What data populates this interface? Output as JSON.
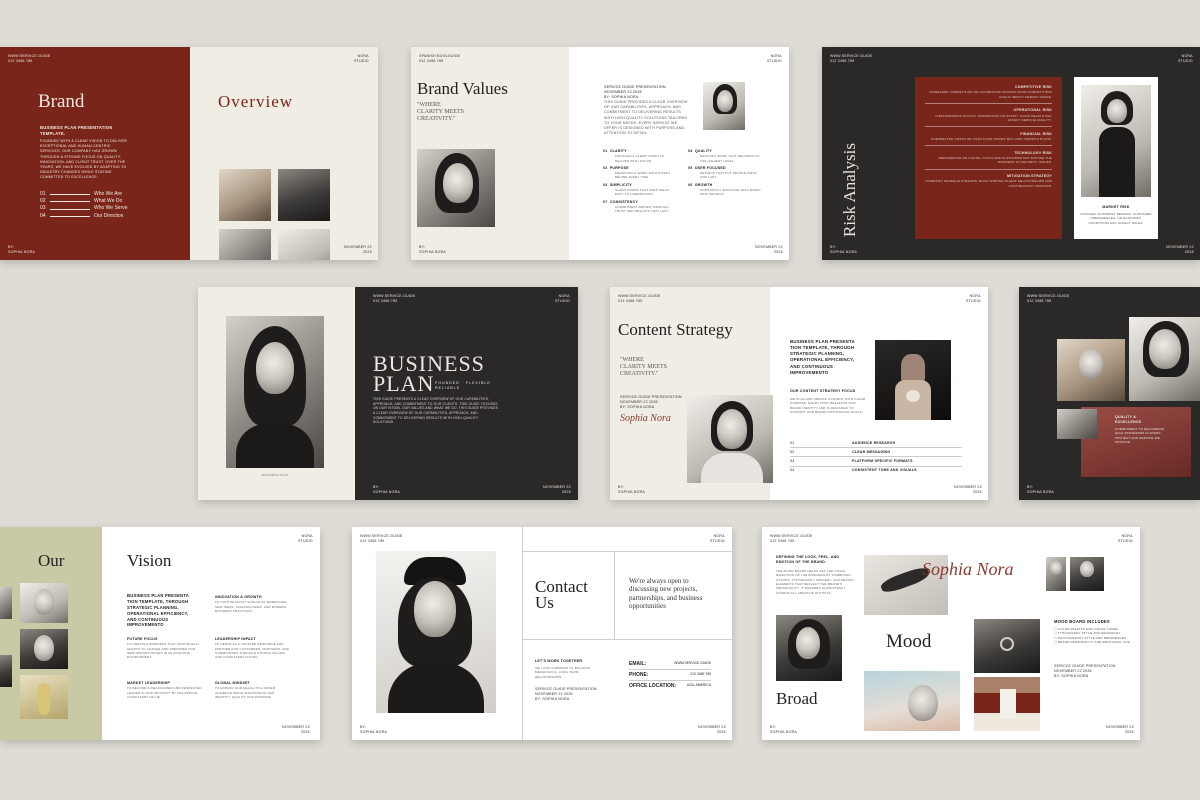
{
  "brand_slide": {
    "contact": "WWW.SERVICE.GUIDE\n012 3456 789",
    "studio": "NORA\nSTUDIO",
    "title": "Brand",
    "overview": "Overview",
    "subtitle": "BUSINESS PLAN PRESENTATION TEMPLATE.",
    "body": "FOUNDED WITH A CLEAR VISION TO DELIVER EXCEPTIONAL AND HUMAN-CENTRIC SERVICES. OUR COMPANY HAS GROWN THROUGH A STRONG FOCUS ON QUALITY, INNOVATION, AND CLIENT TRUST. OVER THE YEARS, WE HAVE EVOLVED BY ADAPTING TO INDUSTRY CHANGES WHILE STAYING COMMITTED TO EXCELLENCE.",
    "menu": [
      {
        "num": "01",
        "label": "Who We Are"
      },
      {
        "num": "02",
        "label": "What We Do"
      },
      {
        "num": "03",
        "label": "Who We Serve"
      },
      {
        "num": "04",
        "label": "Our Direction"
      }
    ],
    "author": "BY:\nSOPHIA NORA",
    "date": "NOVEMBER 22\n2026"
  },
  "values_slide": {
    "contact": "SPANISH BOOLGUIDE\n012 3456 789",
    "studio": "NORA\nSTUDIO",
    "title": "Brand Values",
    "quote": "\"WHERE\nCLARITY MEETS\nCREATIVITY.\"",
    "intro_head": "SERVICE GUIDE PRESENTATION\nNOVEMBER 22 2026\nBY: SOPHIA NORA",
    "intro_body": "THIS GUIDE PROVIDES A CLEAR OVERVIEW OF OUR CAPABILITIES, APPROACH, AND COMMITMENT TO DELIVERING RESULTS WITH HIGH-QUALITY SOLUTIONS TAILORED TO YOUR NEEDS. EVERY SERVICE WE OFFER IS DESIGNED WITH PURPOSE AND ATTENTION TO DETAIL.",
    "values": [
      {
        "num": "01",
        "label": "CLARITY",
        "desc": "THROUGH A CLEAR VISION TO DELIVER WITH FOCUS"
      },
      {
        "num": "04",
        "label": "QUALITY",
        "desc": "DETAILED WORK THAT DELIVERS TO THE HIGHEST LEVEL"
      },
      {
        "num": "02",
        "label": "PURPOSE",
        "desc": "MEANINGFUL WORK WITH INTENT BEHIND EVERY TIME"
      },
      {
        "num": "05",
        "label": "USER FOCUSED",
        "desc": "DESIGNS THAT PUT PEOPLE FIRST AND LAST"
      },
      {
        "num": "03",
        "label": "SIMPLICITY",
        "desc": "CLEAN FORMS THAT KEEP IDEAS EASY TO UNDERSTAND"
      },
      {
        "num": "06",
        "label": "GROWTH",
        "desc": "CONSTANTLY EVOLVING WITH EVERY NEW PROJECT"
      },
      {
        "num": "07",
        "label": "CONSISTENCY",
        "desc": "COMMITMENT DRIVEN THROUGH TRUST AND RESULTS THAT LAST"
      }
    ],
    "author": "BY:\nSOPHIA NORA",
    "date": "NOVEMBER 22\n2026"
  },
  "risk_slide": {
    "contact": "WWW.SERVICE.GUIDE\n012 3456 789",
    "studio": "NORA\nSTUDIO",
    "title": "Risk Analysis",
    "risks": [
      {
        "label": "COMPETITIVE RISK",
        "desc": "INCREASED COMPETITION OR AGGRESSIVE PRICING FROM COMPETITORS COULD IMPACT MARKET SHARE."
      },
      {
        "label": "OPERATIONAL RISK",
        "desc": "INEFFICIENCIES IN DAILY OPERATIONS OR SUPPLY CHAIN DELAYS MAY AFFECT SERVICE QUALITY."
      },
      {
        "label": "FINANCIAL RISK",
        "desc": "UNEXPECTED COSTS OR CASH FLOW ISSUES MAY LIMIT GROWTH PLANS."
      },
      {
        "label": "TECHNOLOGY RISK",
        "desc": "DEPENDENCE ON DIGITAL TOOLS AND PLATFORMS MAY EXPOSE THE BUSINESS TO SECURITY ISSUES."
      },
      {
        "label": "MITIGATION STRATEGY",
        "desc": "DIVERSIFY REVENUE STREAMS, BUILD STRONG CLIENT RELATIONSHIPS AND CONTINUOUSLY MONITOR."
      }
    ],
    "market_label": "MARKET RISK",
    "market_desc": "CHANGES IN MARKET DEMAND, CUSTOMER PREFERENCES, OR ECONOMIC CONDITIONS MAY AFFECT SALES.",
    "author": "BY:\nSOPHIA NORA",
    "date": "NOVEMBER 22\n2026"
  },
  "business_slide": {
    "contact": "WWW.SERVICE.GUIDE\n012 3456 789",
    "studio": "NORA\nSTUDIO",
    "title_line1": "BUSINESS",
    "title_line2": "PLAN",
    "tagline": "FOUNDED · FLEXIBLE\nRELIABLE",
    "body": "THIS GUIDE PRESENTS A CLEAR OVERVIEW OF OUR CAPABILITIES, APPROACH, AND COMMITMENT TO OUR CLIENTS. THIS GUIDE FOCUSES ON OUR VISION, OUR VALUES AND WHAT WE DO. THIS GUIDE PROVIDES A CLEAR OVERVIEW OF OUR CAPABILITIES, APPROACH, AND COMMITMENT TO DELIVERING RESULTS WITH HIGH-QUALITY SOLUTIONS.",
    "photo_caption": "BUSINESS PLAN",
    "author": "BY:\nSOPHIA NORA",
    "date": "NOVEMBER 22\n2026"
  },
  "content_slide": {
    "contact": "WWW.SERVICE.GUIDE\n012 3456 789",
    "studio": "NORA\nSTUDIO",
    "title": "Content Strategy",
    "quote": "\"WHERE\nCLARITY MEETS\nCREATIVITY.\"",
    "meta": "SERVICE GUIDE PRESENTATION\nNOVEMBER 22 2026\nBY: SOPHIA NORA",
    "signature": "Sophia Nora",
    "headline": "BUSINESS PLAN PRESENTA TION TEMPLATE, THROUGH STRATEGIC PLANNING, OPERATIONAL EFFICIENCY, AND CONTINUOUS IMPROVEMENTO",
    "focus_label": "OUR CONTENT STRATEGY FOCUS",
    "focus_body": "WE PLAN AND CREATE CONTENT WITH CLEAR PURPOSE. EVERY POST REFLECTS OUR BRAND IDENTITY AND IS DESIGNED TO SUPPORT OUR BRAND POSITIONING GOALS.",
    "items": [
      {
        "num": "01",
        "label": "AUDIENCE RESEARCH"
      },
      {
        "num": "02",
        "label": "CLEAR MESSAGING"
      },
      {
        "num": "03",
        "label": "PLATFORM SPECIFIC FORMATS"
      },
      {
        "num": "04",
        "label": "CONSISTENT TONE AND VISUALS"
      }
    ],
    "author": "BY:\nSOPHIA NORA",
    "date": "NOVEMBER 22\n2026"
  },
  "dark_slide": {
    "contact": "WWW.SERVICE.GUIDE\n012 3456 789",
    "label": "QUALITY &\nEXCELLENCE",
    "body": "COMMITMENT TO DELIVERING HIGH STANDARDS IN EVERY PROJECT AND SERVICE WE PROVIDE.",
    "author": "BY:\nSOPHIA NORA"
  },
  "vision_slide": {
    "studio": "NORA\nSTUDIO",
    "title_a": "Our",
    "title_b": "Vision",
    "headline": "BUSINESS PLAN PRESENTA TION TEMPLATE, THROUGH STRATEGIC PLANNING, OPERATIONAL EFFICIENCY, AND CONTINUOUS IMPROVEMENTO",
    "points": [
      {
        "label": "INNOVATION & GROWTH",
        "desc": "TO CONTINUOUSLY EVOLVE BY EMBRACING NEW IDEAS, TECHNOLOGIES, AND MODERN BUSINESS PRACTICES."
      },
      {
        "label": "FUTURE FOCUS",
        "desc": "TO CREATE A BUSINESS THAT CONTINUALLY ADAPTS TO CHANGE AND PREPARES FOR NEW OPPORTUNITIES IN AN EVOLVING ENVIRONMENT."
      },
      {
        "label": "LEADERSHIP IMPACT",
        "desc": "TO SERVE AS A TRUSTED RESOURCE AND PARTNER FOR CUSTOMERS, PARTNERS, AND COMMUNITIES THROUGH STRONG VALUES AND CONSISTENT ACTION."
      },
      {
        "label": "MARKET LEADERSHIP",
        "desc": "TO BECOME A RECOGNIZED AND RESPECTED LEADER IN OUR INDUSTRY BY DELIVERING CONSISTENT VALUE."
      },
      {
        "label": "GLOBAL MINDSET",
        "desc": "TO EXPAND OUR REACH TO A WIDER AUDIENCE WHILE MAINTAINING OUR IDENTITY, QUALITY AND PURPOSE."
      }
    ],
    "date": "NOVEMBER 22\n2026"
  },
  "contact_slide": {
    "contact": "WWW.SERVICE.GUIDE\n012 3456 789",
    "studio": "NORA\nSTUDIO",
    "title_line1": "Contact",
    "title_line2": "Us",
    "tagline": "We're always open to discussing new projects, partnerships, and business opportunities",
    "work_label": "LET'S WORK TOGETHER",
    "work_body": "WE LOOK FORWARD TO BUILDING MEANINGFUL, LONG-TERM RELATIONSHIPS.",
    "meta": "SERVICE GUIDE PRESENTATION\nNOVEMBER 22 2026\nBY: SOPHIA NORA",
    "fields": [
      {
        "label": "EMAIL:",
        "value": "WWW.SERVICE.GUIDE"
      },
      {
        "label": "PHONE:",
        "value": "012 3456 789"
      },
      {
        "label": "OFFICE LOCATION:",
        "value": "USA, AMERICA"
      }
    ],
    "author": "BY:\nSOPHIA NORA",
    "date": "NOVEMBER 22\n2026"
  },
  "mood_slide": {
    "contact": "WWW.SERVICE.GUIDE\n012 3456 789",
    "studio": "NORA\nSTUDIO",
    "intro": "DEFINING THE LOOK, FEEL, AND EMOTION OF THE BRAND.",
    "body": "THE MOOD BOARD HELPS SET THE VISUAL DIRECTION OF THE BUSINESS BY COMBINING COLORS, TYPOGRAPHY, IMAGERY, AND DESIGN ELEMENTS THAT REFLECT THE BRAND'S PERSONALITY. IT ENSURES CONSISTENCY ACROSS ALL CREATIVE OUTPUTS.",
    "signature": "Sophia Nora",
    "mood": "Mood",
    "broad": "Broad",
    "includes_label": "MOOD BOARD INCLUDES",
    "includes": [
      "COLOR PALETTE AND VISUAL TONES",
      "TYPOGRAPHY STYLE AND HIERARCHY",
      "PHOTOGRAPHY STYLE AND REFERENCES",
      "BRAND PERSONALITY AND EMOTIONAL CUE"
    ],
    "meta": "SERVICE GUIDE PRESENTATION\nNOVEMBER 22 2026\nBY: SOPHIA NORA",
    "author": "BY:\nSOPHIA NORA",
    "date": "NOVEMBER 22\n2026"
  },
  "colors": {
    "background": "#dedcd5",
    "brand_red": "#7a2519",
    "cream": "#efede4",
    "charcoal": "#2b2928",
    "sage": "#c9c9a6",
    "white": "#ffffff",
    "script_red": "#8a3a32"
  }
}
